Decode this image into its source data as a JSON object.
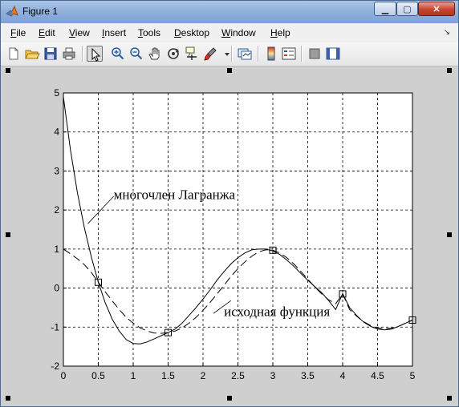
{
  "window": {
    "title": "Figure 1",
    "buttons": {
      "minimize": "▁",
      "maximize": "▢",
      "close": "✕"
    }
  },
  "menu": {
    "items": [
      "File",
      "Edit",
      "View",
      "Insert",
      "Tools",
      "Desktop",
      "Window",
      "Help"
    ],
    "overflow_arrow": "↘"
  },
  "toolbar": {
    "icons": [
      "new-file-icon",
      "open-folder-icon",
      "save-icon",
      "print-icon",
      "pointer-icon",
      "zoom-in-icon",
      "zoom-out-icon",
      "pan-hand-icon",
      "rotate-3d-icon",
      "data-cursor-icon",
      "brush-icon",
      "brush-dropdown-icon",
      "link-plot-icon",
      "colorbar-icon",
      "legend-icon",
      "hide-plot-tools-icon",
      "show-plot-tools-icon"
    ],
    "active": "pointer-icon"
  },
  "chart_data": {
    "type": "line",
    "title": "",
    "xlabel": "",
    "ylabel": "",
    "xlim": [
      0,
      5
    ],
    "ylim": [
      -2,
      5
    ],
    "grid": true,
    "xticks": [
      "0",
      "0.5",
      "1",
      "1.5",
      "2",
      "2.5",
      "3",
      "3.5",
      "4",
      "4.5",
      "5"
    ],
    "yticks": [
      "-2",
      "-1",
      "0",
      "1",
      "2",
      "3",
      "4",
      "5"
    ],
    "series": [
      {
        "name": "многочлен Лагранжа",
        "style": "solid",
        "x": [
          0,
          0.1,
          0.2,
          0.3,
          0.4,
          0.5,
          0.6,
          0.7,
          0.8,
          0.9,
          1.0,
          1.1,
          1.2,
          1.3,
          1.4,
          1.5,
          1.6,
          1.7,
          1.8,
          1.9,
          2.0,
          2.1,
          2.2,
          2.3,
          2.4,
          2.5,
          2.6,
          2.7,
          2.8,
          2.9,
          3.0,
          3.1,
          3.2,
          3.3,
          3.4,
          3.5,
          3.6,
          3.7,
          3.8,
          3.9,
          4.0,
          4.1,
          4.2,
          4.3,
          4.4,
          4.5,
          4.6,
          4.7,
          4.8,
          4.9,
          5.0
        ],
        "y": [
          4.9,
          3.55,
          2.45,
          1.55,
          0.8,
          0.15,
          -0.38,
          -0.8,
          -1.1,
          -1.32,
          -1.42,
          -1.43,
          -1.38,
          -1.3,
          -1.22,
          -1.14,
          -1.05,
          -0.9,
          -0.7,
          -0.5,
          -0.28,
          -0.05,
          0.2,
          0.42,
          0.62,
          0.78,
          0.9,
          0.98,
          1.0,
          1.0,
          0.95,
          0.86,
          0.72,
          0.56,
          0.38,
          0.2,
          0.04,
          -0.12,
          -0.32,
          -0.55,
          -0.14,
          -0.5,
          -0.7,
          -0.87,
          -0.98,
          -1.05,
          -1.07,
          -1.05,
          -0.98,
          -0.9,
          -0.82
        ]
      },
      {
        "name": "исходная функция",
        "style": "dashed",
        "x": [
          0,
          0.1,
          0.2,
          0.3,
          0.4,
          0.5,
          0.6,
          0.7,
          0.8,
          0.9,
          1.0,
          1.1,
          1.2,
          1.3,
          1.4,
          1.5,
          1.6,
          1.7,
          1.8,
          1.9,
          2.0,
          2.1,
          2.2,
          2.3,
          2.4,
          2.5,
          2.6,
          2.7,
          2.8,
          2.9,
          3.0,
          3.1,
          3.2,
          3.3,
          3.4,
          3.5,
          3.6,
          3.7,
          3.8,
          3.9,
          4.0,
          4.1,
          4.2,
          4.3,
          4.4,
          4.5,
          4.6,
          4.7,
          4.8,
          4.9,
          5.0
        ],
        "y": [
          1.0,
          0.88,
          0.75,
          0.6,
          0.4,
          0.15,
          -0.1,
          -0.33,
          -0.55,
          -0.75,
          -0.9,
          -1.02,
          -1.1,
          -1.15,
          -1.16,
          -1.14,
          -1.1,
          -1.02,
          -0.9,
          -0.75,
          -0.57,
          -0.37,
          -0.15,
          0.07,
          0.3,
          0.5,
          0.67,
          0.82,
          0.93,
          0.98,
          0.97,
          0.9,
          0.78,
          0.62,
          0.43,
          0.23,
          0.03,
          -0.15,
          -0.3,
          -0.4,
          -0.15,
          -0.55,
          -0.72,
          -0.86,
          -0.96,
          -1.02,
          -1.04,
          -1.03,
          -0.98,
          -0.9,
          -0.82
        ]
      }
    ],
    "nodes": {
      "x": [
        0.5,
        1.5,
        3.0,
        4.0,
        5.0
      ],
      "y": [
        0.15,
        -1.14,
        0.97,
        -0.15,
        -0.82
      ]
    },
    "annotations": [
      "многочлен Лагранжа",
      "исходная функция"
    ]
  }
}
